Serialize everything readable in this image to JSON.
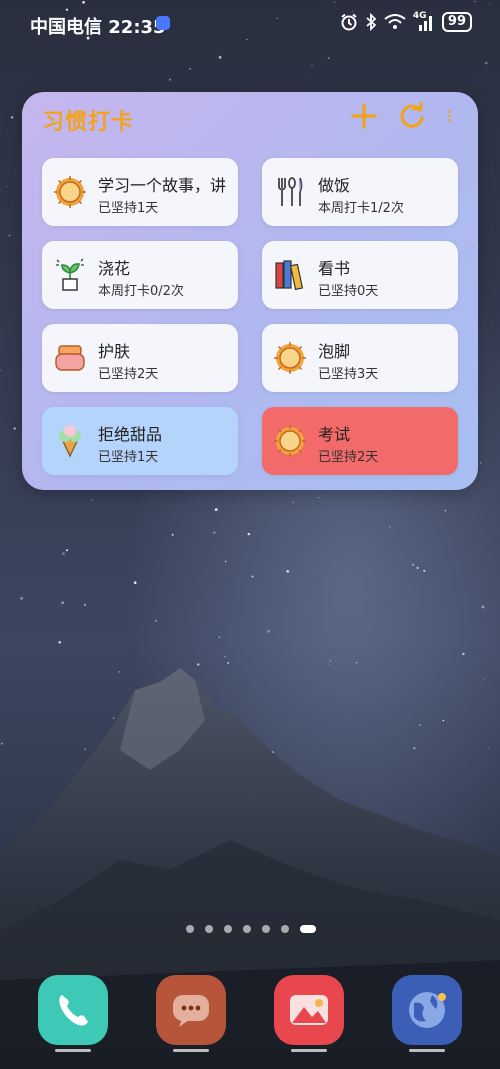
{
  "status_bar": {
    "carrier_time": "中国电信 22:35",
    "network_label": "4G",
    "battery": "99"
  },
  "widget": {
    "title": "习惯打卡",
    "cards": [
      {
        "name": "学习一个故事，讲",
        "sub": "已坚持1天",
        "icon": "sun-icon",
        "color": "#f4f6fb"
      },
      {
        "name": "做饭",
        "sub": "本周打卡1/2次",
        "icon": "utensils-icon",
        "color": "#f4f6fb"
      },
      {
        "name": "浇花",
        "sub": "本周打卡0/2次",
        "icon": "plant-icon",
        "color": "#f4f6fb"
      },
      {
        "name": "看书",
        "sub": "已坚持0天",
        "icon": "books-icon",
        "color": "#f4f6fb"
      },
      {
        "name": "护肤",
        "sub": "已坚持2天",
        "icon": "cream-jar-icon",
        "color": "#f4f6fb"
      },
      {
        "name": "泡脚",
        "sub": "已坚持3天",
        "icon": "sun-icon",
        "color": "#f4f6fb"
      },
      {
        "name": "拒绝甜品",
        "sub": "已坚持1天",
        "icon": "ice-cream-icon",
        "color": "#b5d4fb"
      },
      {
        "name": "考试",
        "sub": "已坚持2天",
        "icon": "sun-icon",
        "color": "#f26a6a"
      }
    ]
  },
  "pager": {
    "count": 7,
    "active": 6
  },
  "dock": [
    {
      "name": "phone-app",
      "color": "#3ec9b6"
    },
    {
      "name": "messages-app",
      "color": "#b7553a"
    },
    {
      "name": "gallery-app",
      "color": "#e8474e"
    },
    {
      "name": "browser-app",
      "color": "#3b5fb6"
    }
  ]
}
